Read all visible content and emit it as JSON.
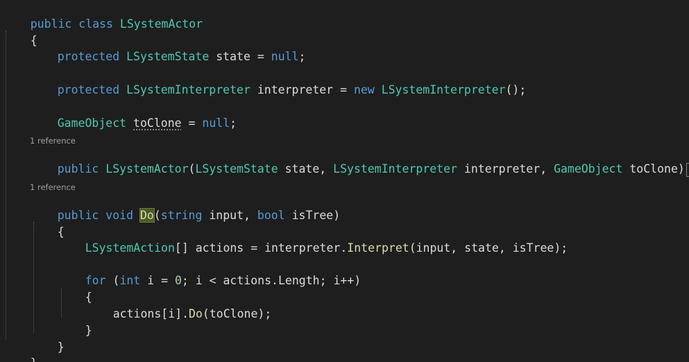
{
  "code": {
    "l1": {
      "kw1": "public",
      "kw2": "class",
      "name": "LSystemActor"
    },
    "brace_open": "{",
    "brace_close": "}",
    "l3": {
      "kw": "protected",
      "type": "LSystemState",
      "ident": "state",
      "eq": "=",
      "val": "null",
      "semi": ";"
    },
    "l5": {
      "kw": "protected",
      "type": "LSystemInterpreter",
      "ident": "interpreter",
      "eq": "=",
      "kw_new": "new",
      "ctor": "LSystemInterpreter",
      "call": "();"
    },
    "l7": {
      "type": "GameObject",
      "ident": "toClone",
      "eq": "=",
      "val": "null",
      "semi": ";"
    },
    "ref1": "1 reference",
    "l9": {
      "kw": "public",
      "name": "LSystemActor",
      "p_open": "(",
      "t1": "LSystemState",
      "a1": "state",
      "c1": ",",
      "t2": "LSystemInterpreter",
      "a2": "interpreter",
      "c2": ",",
      "t3": "GameObject",
      "a3": "toClone",
      "p_close": ")",
      "collapsed": "..."
    },
    "ref2": "1 reference",
    "l11": {
      "kw1": "public",
      "kw2": "void",
      "name": "Do",
      "p_open": "(",
      "t1": "string",
      "a1": "input",
      "c1": ",",
      "t2": "bool",
      "a2": "isTree",
      "p_close": ")"
    },
    "l12": "{",
    "l13": {
      "type": "LSystemAction",
      "brackets": "[]",
      "ident": "actions",
      "eq": "=",
      "obj": "interpreter",
      "dot": ".",
      "method": "Interpret",
      "p_open": "(",
      "a1": "input",
      "c1": ",",
      "a2": "state",
      "c2": ",",
      "a3": "isTree",
      "p_close": ");"
    },
    "l15": {
      "kw": "for",
      "p_open": "(",
      "t": "int",
      "i": "i",
      "eq": "=",
      "zero": "0",
      "semi1": ";",
      "i2": "i",
      "lt": "<",
      "arr": "actions",
      "dot": ".",
      "prop": "Length",
      "semi2": ";",
      "inc": "i++",
      "p_close": ")"
    },
    "l16": "{",
    "l17": {
      "arr": "actions",
      "idx": "[i]",
      "dot": ".",
      "method": "Do",
      "p_open": "(",
      "arg": "toClone",
      "p_close": ");"
    },
    "l18": "}",
    "l19": "}",
    "ws_dot": "·"
  }
}
